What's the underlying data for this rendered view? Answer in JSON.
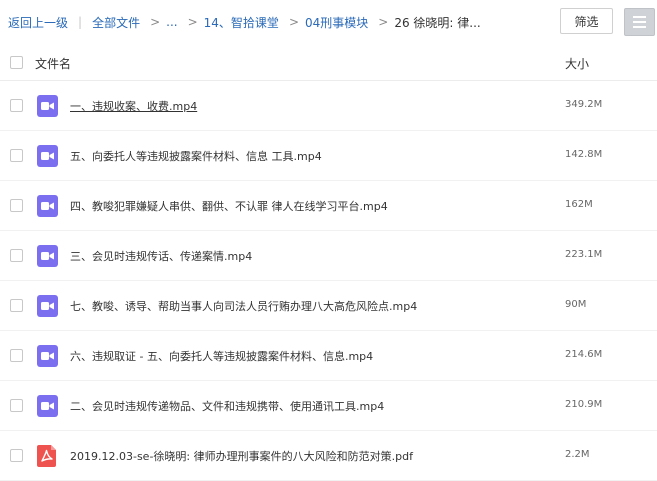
{
  "breadcrumb": {
    "back_label": "返回上一级",
    "all_files_label": "全部文件",
    "ellipsis": "...",
    "item1": "14、智拾课堂",
    "item2": "04刑事模块",
    "current": "26 徐晓明: 律..."
  },
  "toolbar": {
    "filter_label": "筛选"
  },
  "list_header": {
    "name_label": "文件名",
    "size_label": "大小"
  },
  "files": [
    {
      "name": "一、违规收案、收费.mp4",
      "size": "349.2M",
      "type": "video"
    },
    {
      "name": "五、向委托人等违规披露案件材料、信息 工具.mp4",
      "size": "142.8M",
      "type": "video"
    },
    {
      "name": "四、教唆犯罪嫌疑人串供、翻供、不认罪 律人在线学习平台.mp4",
      "size": "162M",
      "type": "video"
    },
    {
      "name": "三、会见时违规传话、传递案情.mp4",
      "size": "223.1M",
      "type": "video"
    },
    {
      "name": "七、教唆、诱导、帮助当事人向司法人员行贿办理八大高危风险点.mp4",
      "size": "90M",
      "type": "video"
    },
    {
      "name": "六、违规取证 - 五、向委托人等违规披露案件材料、信息.mp4",
      "size": "214.6M",
      "type": "video"
    },
    {
      "name": "二、会见时违规传递物品、文件和违规携带、使用通讯工具.mp4",
      "size": "210.9M",
      "type": "video"
    },
    {
      "name": "2019.12.03-se-徐晓明: 律师办理刑事案件的八大风险和防范对策.pdf",
      "size": "2.2M",
      "type": "pdf"
    }
  ],
  "colors": {
    "video_icon": "#7b6ff0",
    "pdf_icon": "#ef5350",
    "link": "#2a6ab8"
  }
}
